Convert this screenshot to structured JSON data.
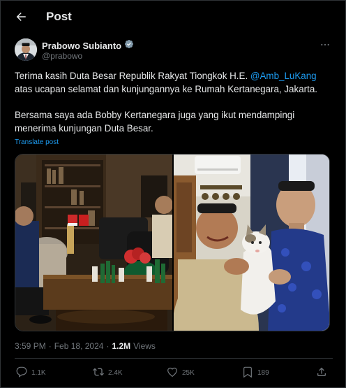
{
  "header": {
    "title": "Post"
  },
  "author": {
    "name": "Prabowo Subianto",
    "handle": "@prabowo",
    "verified_icon": "verified-badge-icon"
  },
  "post": {
    "p1_pre": "Terima kasih Duta Besar Republik Rakyat Tiongkok H.E. ",
    "p1_mention": "@Amb_LuKang",
    "p1_post": " atas ucapan selamat dan kunjungannya ke Rumah Kertanegara, Jakarta.",
    "p2": "Bersama saya ada Bobby Kertanegara juga yang ikut mendampingi menerima kunjungan Duta Besar.",
    "translate": "Translate post"
  },
  "meta": {
    "time": "3:59 PM",
    "separator": "·",
    "date": "Feb 18, 2024",
    "views_count": "1.2M",
    "views_label": "Views"
  },
  "actions": {
    "replies": "1.1K",
    "reposts": "2.4K",
    "likes": "25K",
    "bookmarks": "189"
  },
  "colors": {
    "background": "#000000",
    "text": "#e7e9ea",
    "secondary": "#71767b",
    "accent": "#1d9bf0",
    "border": "#2f3336"
  }
}
